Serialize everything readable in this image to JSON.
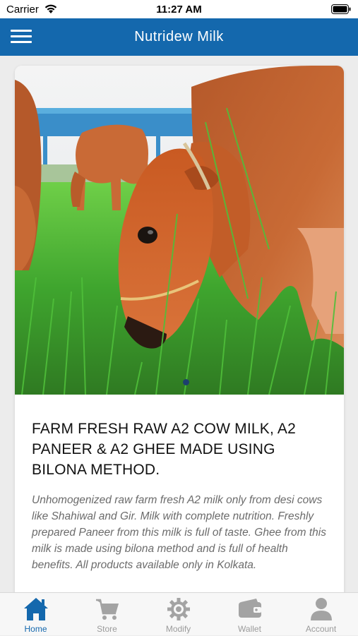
{
  "status_bar": {
    "carrier": "Carrier",
    "time": "11:27 AM",
    "icons": [
      "wifi-icon",
      "battery-icon"
    ]
  },
  "header": {
    "title": "Nutridew Milk",
    "menu_icon": "hamburger-menu-icon",
    "background_color": "#1468ad"
  },
  "product_card": {
    "image_alt": "Red Sahiwal cows grazing on green grass",
    "carousel_active_index": 0,
    "title": "FARM FRESH RAW A2 COW MILK, A2 PANEER & A2 GHEE MADE USING BILONA METHOD.",
    "description": "Unhomogenized raw farm fresh A2 milk only from desi cows like Shahiwal and Gir. Milk with complete nutrition. Freshly prepared Paneer from this milk is full of taste. Ghee from this milk is made using bilona method and is full of health benefits. All products available only in Kolkata."
  },
  "tab_bar": {
    "active_color": "#1468ad",
    "inactive_color": "#9b9b9b",
    "tabs": [
      {
        "label": "Home",
        "icon": "home-icon",
        "active": true
      },
      {
        "label": "Store",
        "icon": "cart-icon",
        "active": false
      },
      {
        "label": "Modify",
        "icon": "gear-icon",
        "active": false
      },
      {
        "label": "Wallet",
        "icon": "wallet-icon",
        "active": false
      },
      {
        "label": "Account",
        "icon": "user-icon",
        "active": false
      }
    ]
  }
}
